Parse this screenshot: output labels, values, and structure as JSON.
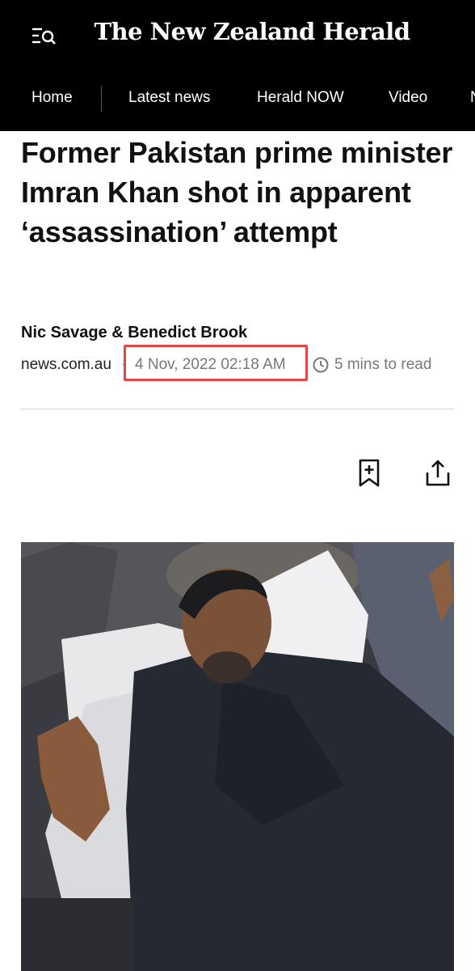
{
  "header": {
    "masthead": "The New Zealand Herald",
    "menu_icon": "menu-search-icon"
  },
  "nav": {
    "items": [
      "Home",
      "Latest news",
      "Herald NOW",
      "Video",
      "N"
    ]
  },
  "article": {
    "headline": "Former Pakistan prime minister Imran Khan shot in apparent ‘assassination’ attempt",
    "byline": "Nic Savage & Benedict Brook",
    "source": "news.com.au",
    "separator": "·",
    "date": "4 Nov, 2022 02:18 AM",
    "read_time": "5 mins to read",
    "clock_icon": "clock-icon",
    "bookmark_icon": "bookmark-add-icon",
    "share_icon": "share-icon"
  },
  "colors": {
    "header_bg": "#000000",
    "highlight": "#e04848",
    "meta_grey": "#777777"
  }
}
